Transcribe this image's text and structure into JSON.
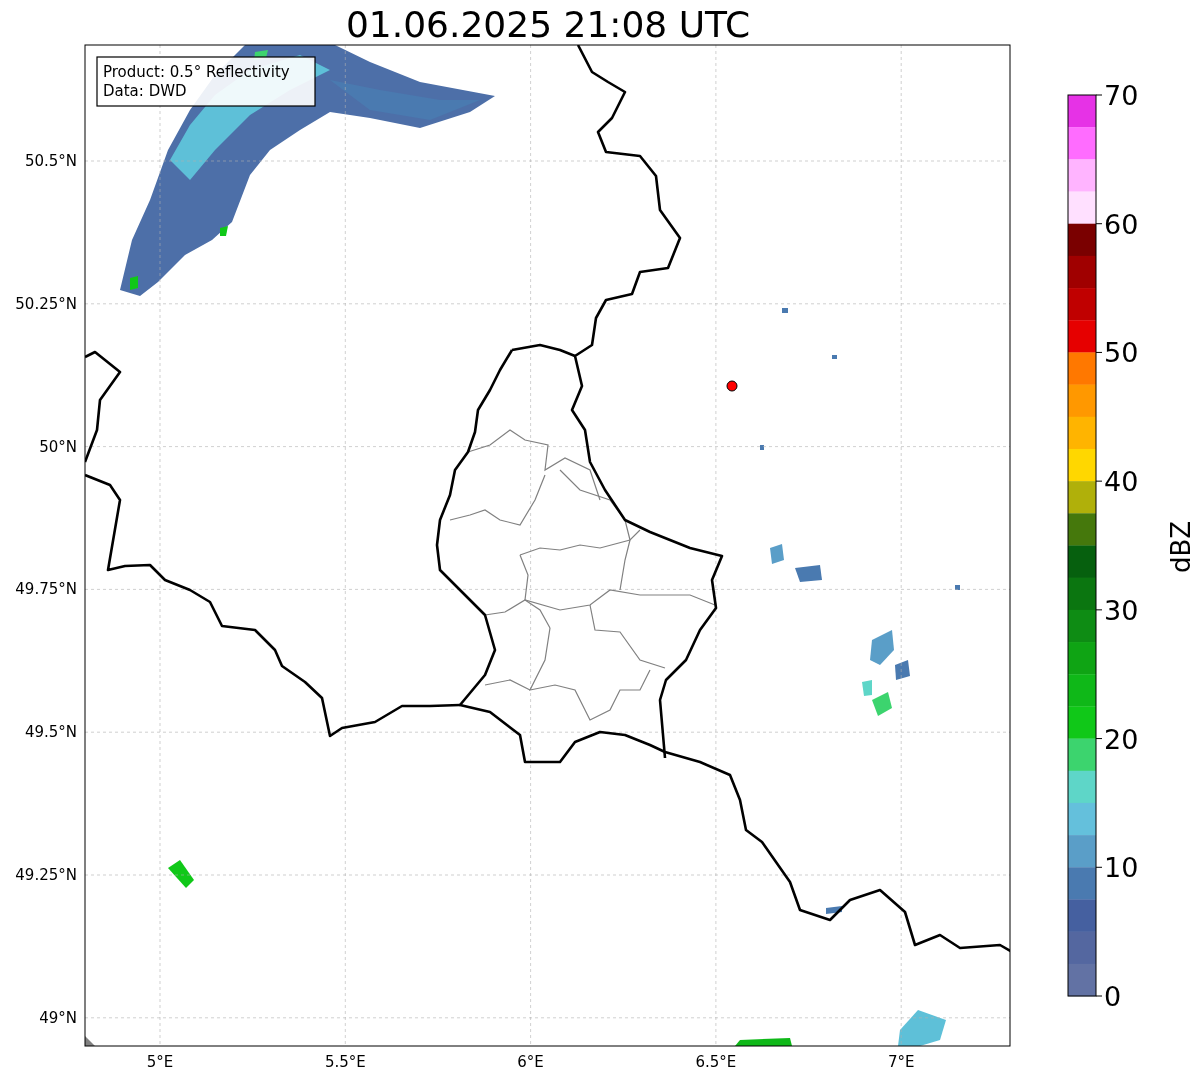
{
  "title": "01.06.2025 21:08 UTC",
  "annotation": [
    "Product: 0.5° Reflectivity",
    "Data: DWD"
  ],
  "x_ticks": [
    "5°E",
    "5.5°E",
    "6°E",
    "6.5°E",
    "7°E"
  ],
  "y_ticks": [
    "50.5°N",
    "50.25°N",
    "50°N",
    "49.75°N",
    "49.5°N",
    "49.25°N",
    "49°N"
  ],
  "colorbar": {
    "label": "dBZ",
    "ticks": [
      "70",
      "60",
      "50",
      "40",
      "30",
      "20",
      "10",
      "0"
    ],
    "bins": [
      {
        "color": "#e632e6"
      },
      {
        "color": "#ff6cff"
      },
      {
        "color": "#ffb4ff"
      },
      {
        "color": "#ffe0ff"
      },
      {
        "color": "#7a0000"
      },
      {
        "color": "#a00000"
      },
      {
        "color": "#c00000"
      },
      {
        "color": "#e60000"
      },
      {
        "color": "#ff7800"
      },
      {
        "color": "#ff9800"
      },
      {
        "color": "#ffb400"
      },
      {
        "color": "#ffd700"
      },
      {
        "color": "#b0b00a"
      },
      {
        "color": "#45780c"
      },
      {
        "color": "#06600e"
      },
      {
        "color": "#0b7610"
      },
      {
        "color": "#0e8c14"
      },
      {
        "color": "#0fa414"
      },
      {
        "color": "#0fb818"
      },
      {
        "color": "#10c818"
      },
      {
        "color": "#3cd46e"
      },
      {
        "color": "#5ed6c8"
      },
      {
        "color": "#64c0dc"
      },
      {
        "color": "#5a9ec8"
      },
      {
        "color": "#4a7ab0"
      },
      {
        "color": "#4560a0"
      },
      {
        "color": "#5467a0"
      },
      {
        "color": "#6272a4"
      }
    ]
  }
}
